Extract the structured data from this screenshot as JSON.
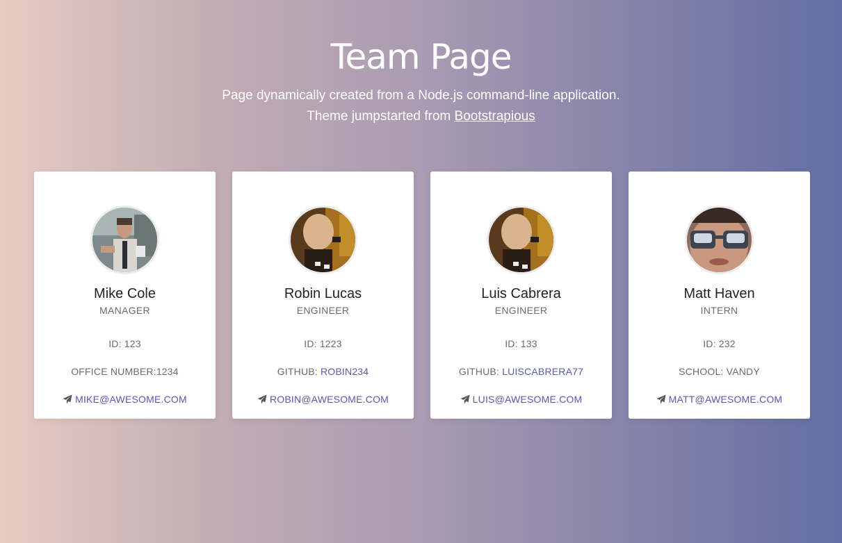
{
  "header": {
    "title": "Team Page",
    "subtitle_1": "Page dynamically created from a Node.js command-line application.",
    "subtitle_2_prefix": "Theme jumpstarted from ",
    "subtitle_2_link": "Bootstrapious"
  },
  "team": [
    {
      "name": "Mike Cole",
      "role": "MANAGER",
      "id_text": "ID: 123",
      "extra_label": "OFFICE NUMBER:",
      "extra_value": "1234",
      "email": "MIKE@AWESOME.COM",
      "avatar_icon": "avatar-photo"
    },
    {
      "name": "Robin Lucas",
      "role": "ENGINEER",
      "id_text": "ID: 1223",
      "extra_label": "GITHUB: ",
      "extra_value": "ROBIN234",
      "email": "ROBIN@AWESOME.COM",
      "avatar_icon": "avatar-photo"
    },
    {
      "name": "Luis Cabrera",
      "role": "ENGINEER",
      "id_text": "ID: 133",
      "extra_label": "GITHUB: ",
      "extra_value": "LUISCABRERA77",
      "email": "LUIS@AWESOME.COM",
      "avatar_icon": "avatar-photo"
    },
    {
      "name": "Matt Haven",
      "role": "INTERN",
      "id_text": "ID: 232",
      "extra_label": "SCHOOL: ",
      "extra_value": "VANDY",
      "email": "MATT@AWESOME.COM",
      "avatar_icon": "avatar-photo"
    }
  ],
  "icons": {
    "email": "paper-plane-icon"
  },
  "colors": {
    "link": "#5a55bd",
    "gradient_start": "#e8cbc1",
    "gradient_end": "#626ea4"
  }
}
